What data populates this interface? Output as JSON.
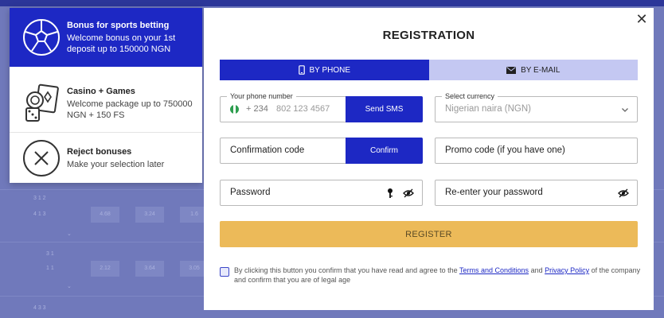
{
  "bonuses": {
    "sports": {
      "title": "Bonus for sports betting",
      "desc": "Welcome bonus on your 1st deposit up to 150000 NGN"
    },
    "casino": {
      "title": "Casino + Games",
      "desc": "Welcome package up to 750000 NGN + 150 FS"
    },
    "reject": {
      "title": "Reject bonuses",
      "desc": "Make your selection later"
    }
  },
  "background": {
    "odds": [
      "4.68",
      "3.24",
      "1.6",
      "2.12",
      "3.64",
      "3.05"
    ]
  },
  "modal": {
    "title": "REGISTRATION",
    "close": "✕",
    "tabs": {
      "phone": "BY PHONE",
      "email": "BY E-MAIL"
    },
    "phone": {
      "legend": "Your phone number",
      "code": "+ 234",
      "placeholder": "802 123 4567",
      "send_sms": "Send SMS"
    },
    "currency": {
      "legend": "Select currency",
      "value": "Nigerian naira (NGN)"
    },
    "confirmation": {
      "placeholder": "Confirmation code",
      "button": "Confirm"
    },
    "promo": {
      "placeholder": "Promo code (if you have one)"
    },
    "password": {
      "placeholder": "Password"
    },
    "repassword": {
      "placeholder": "Re-enter your password"
    },
    "register": "REGISTER",
    "agreement": {
      "part1": "By clicking this button you confirm that you have read and agree to the ",
      "terms": "Terms and Conditions",
      "part2": " and ",
      "privacy": "Privacy Policy",
      "part3": " of the company and confirm that you are of legal age"
    }
  },
  "colors": {
    "primary": "#1d28c4",
    "tab_inactive": "#c4c8f2",
    "register": "#ecba59",
    "overlay": "#7079bb"
  },
  "icons": {
    "sports": "soccer-ball-icon",
    "casino": "casino-cards-dice-icon",
    "reject": "reject-x-icon",
    "phone_tab": "mobile-phone-icon",
    "email_tab": "envelope-icon",
    "currency": "chevron-down-icon",
    "password": "key-icon",
    "visibility": "eye-slash-icon"
  }
}
